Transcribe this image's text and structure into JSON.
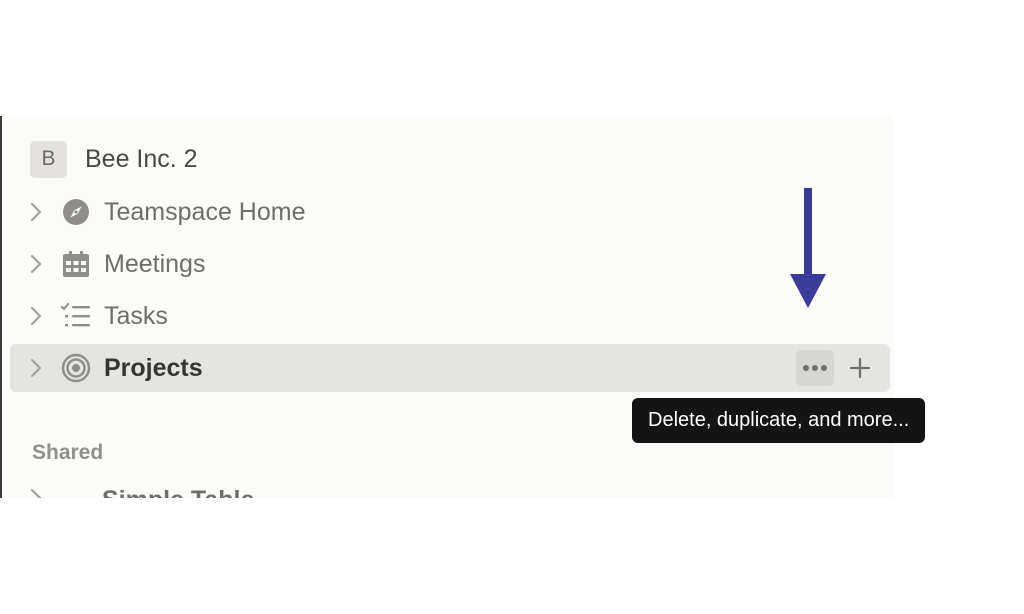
{
  "workspace": {
    "avatar_letter": "B",
    "name": "Bee Inc. 2"
  },
  "nav": {
    "items": [
      {
        "label": "Teamspace Home",
        "icon": "compass-icon"
      },
      {
        "label": "Meetings",
        "icon": "calendar-icon"
      },
      {
        "label": "Tasks",
        "icon": "checklist-icon"
      },
      {
        "label": "Projects",
        "icon": "target-icon",
        "active": true
      }
    ]
  },
  "actions": {
    "more": "•••",
    "add": "+"
  },
  "sections": {
    "shared_label": "Shared",
    "shared_first_item_partial": "Simple Table"
  },
  "tooltip": {
    "text": "Delete, duplicate, and more..."
  },
  "colors": {
    "sidebar_bg": "#fbfbfa",
    "active_row_bg": "#e4e4e2",
    "tooltip_bg": "#141414",
    "annotation_arrow": "#3b3b98"
  }
}
